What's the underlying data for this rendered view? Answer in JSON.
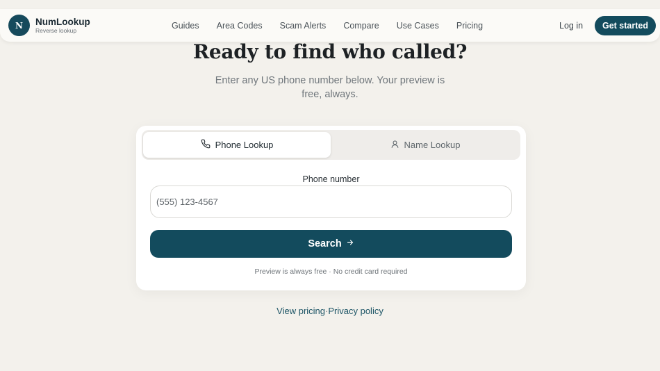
{
  "brand": {
    "logo_letter": "N",
    "name": "NumLookup",
    "tagline": "Reverse lookup"
  },
  "nav": {
    "items": [
      "Guides",
      "Area Codes",
      "Scam Alerts",
      "Compare",
      "Use Cases",
      "Pricing"
    ],
    "login_label": "Log in",
    "cta_label": "Get started"
  },
  "hero": {
    "title": "Ready to find who called?",
    "subtitle": "Enter any US phone number below. Your preview is free, always."
  },
  "search_card": {
    "tabs": [
      {
        "label": "Phone Lookup",
        "icon": "phone-icon",
        "active": true
      },
      {
        "label": "Name Lookup",
        "icon": "person-icon",
        "active": false
      }
    ],
    "field_label": "Phone number",
    "input_placeholder": "(555) 123-4567",
    "input_value": "",
    "search_label": "Search",
    "search_icon": "arrow-right-icon",
    "note": "Preview is always free · No credit card required"
  },
  "footer": {
    "pricing_link": "View pricing",
    "separator": "·",
    "privacy_link": "Privacy policy"
  },
  "colors": {
    "background": "#f3f1ec",
    "accent": "#134b5d",
    "card": "#ffffff"
  }
}
